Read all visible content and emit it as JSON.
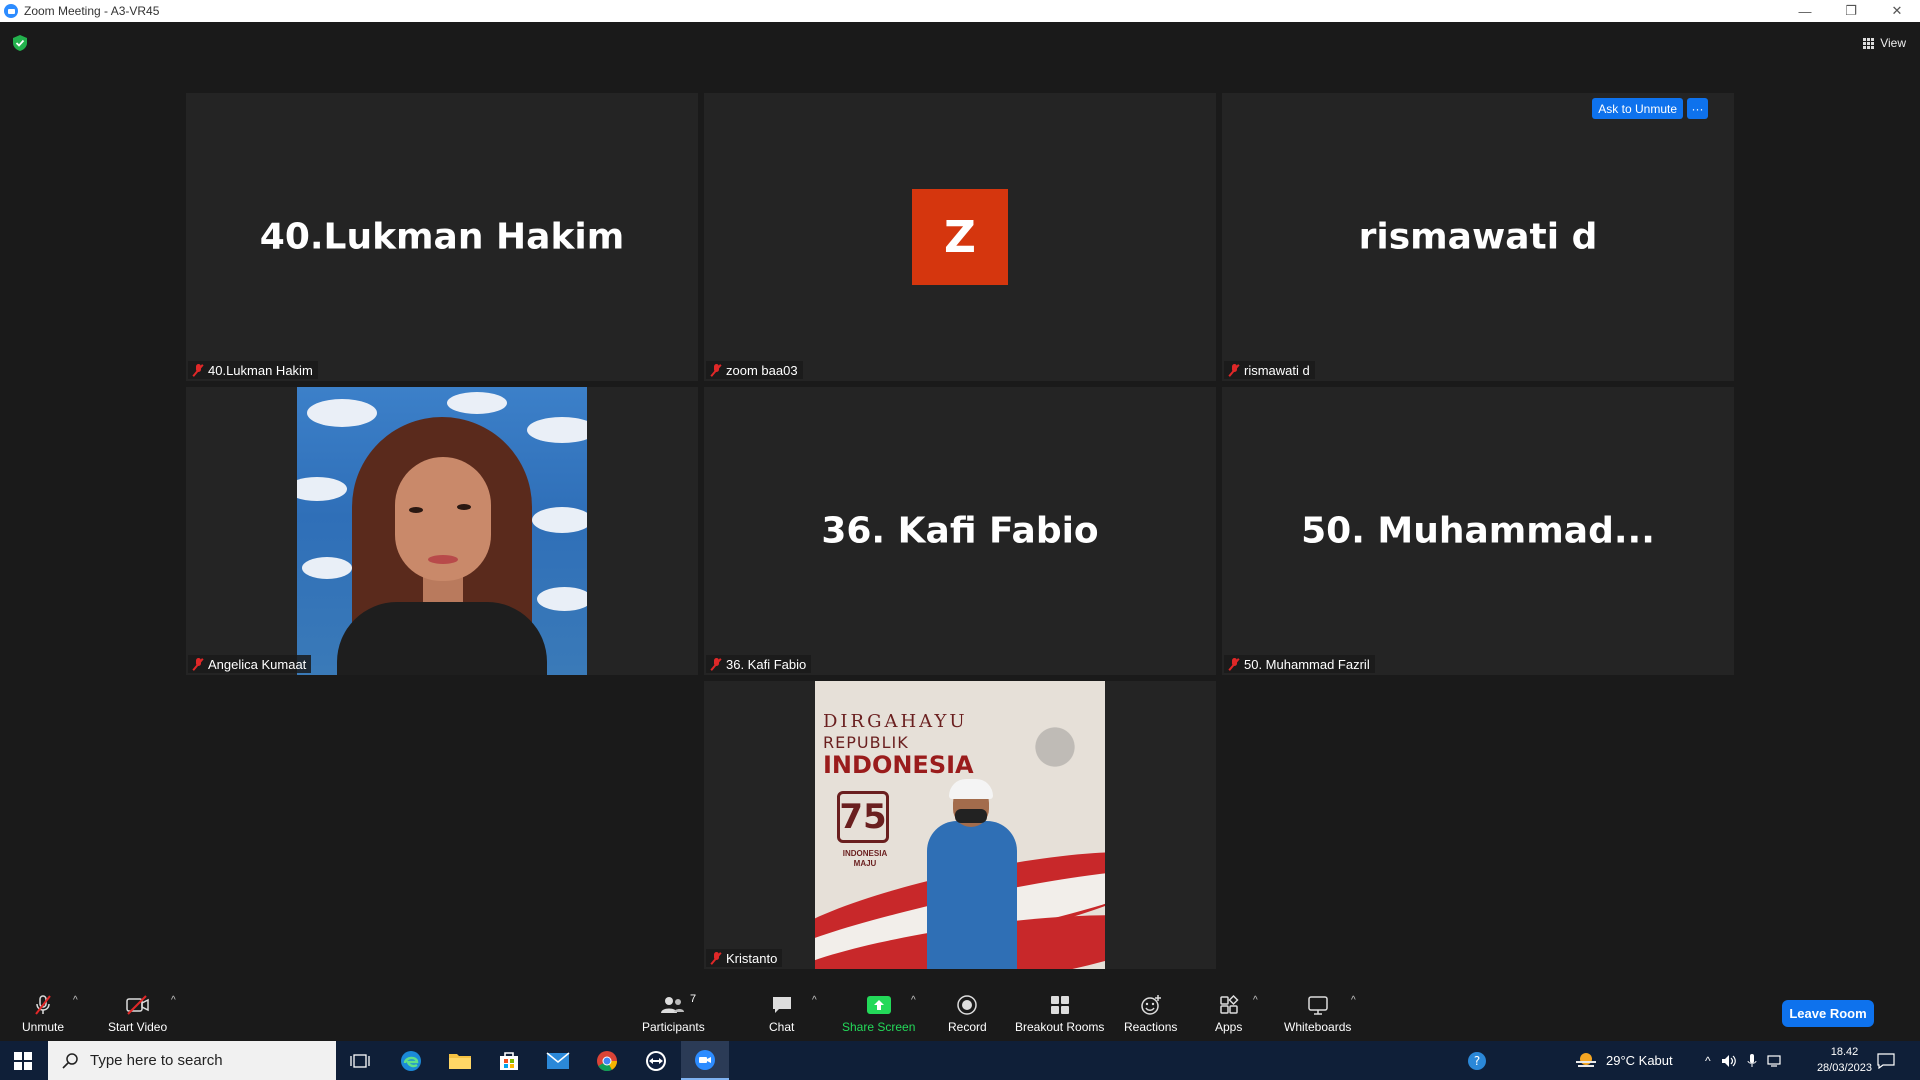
{
  "window": {
    "title": "Zoom Meeting - A3-VR45",
    "minimize": "—",
    "restore": "❐",
    "close": "✕"
  },
  "top": {
    "view_label": "View"
  },
  "tiles": [
    {
      "display_name": "40.Lukman Hakim",
      "tag": "40.Lukman Hakim"
    },
    {
      "avatar_letter": "Z",
      "tag": "zoom baa03",
      "avatar_color": "#d5360e"
    },
    {
      "display_name": "rismawati d",
      "tag": "rismawati d",
      "ask_to_unmute": "Ask to Unmute",
      "more": "···"
    },
    {
      "tag": "Angelica Kumaat"
    },
    {
      "display_name": "36. Kafi Fabio",
      "tag": "36. Kafi Fabio"
    },
    {
      "display_name": "50.  Muhammad...",
      "tag": "50. Muhammad Fazril"
    },
    {
      "tag": "Kristanto",
      "banner_line1": "DIRGAHAYU",
      "banner_line2": "REPUBLIK",
      "banner_line3": "INDONESIA",
      "banner_number": "75",
      "banner_tagline": "INDONESIA MAJU"
    }
  ],
  "toolbar": {
    "unmute": "Unmute",
    "start_video": "Start Video",
    "participants": "Participants",
    "participants_count": "7",
    "chat": "Chat",
    "share_screen": "Share Screen",
    "record": "Record",
    "breakout_rooms": "Breakout Rooms",
    "reactions": "Reactions",
    "apps": "Apps",
    "whiteboards": "Whiteboards",
    "leave_room": "Leave Room"
  },
  "taskbar": {
    "search_placeholder": "Type here to search",
    "weather": "29°C  Kabut",
    "time": "18.42",
    "date": "28/03/2023"
  },
  "colors": {
    "accent": "#0e72ed",
    "share_green": "#23d959",
    "mute_red": "#e02828"
  }
}
